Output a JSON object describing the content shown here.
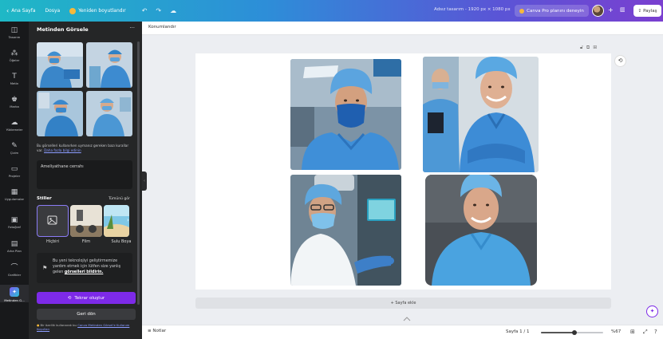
{
  "topbar": {
    "home": "Ana Sayfa",
    "file": "Dosya",
    "resize": "Yeniden boyutlandır",
    "design_size": "Adsız tasarım - 1920 px × 1080 px",
    "pro_cta": "Canva Pro planını deneyin",
    "share": "Paylaş",
    "gradient_start": "#1fb8c6",
    "gradient_end": "#7a3fd0"
  },
  "rail": {
    "items": [
      {
        "label": "Tasarım",
        "icon": "layout-icon"
      },
      {
        "label": "Öğeler",
        "icon": "elements-icon"
      },
      {
        "label": "Metin",
        "icon": "text-icon"
      },
      {
        "label": "Marka",
        "icon": "brand-icon"
      },
      {
        "label": "Yüklemeler",
        "icon": "upload-icon"
      },
      {
        "label": "Çizim",
        "icon": "draw-icon"
      },
      {
        "label": "Projeler",
        "icon": "folder-icon"
      },
      {
        "label": "Uygulamalar",
        "icon": "apps-icon"
      },
      {
        "label": "Fotoğraf",
        "icon": "photo-icon"
      },
      {
        "label": "Arka Plan",
        "icon": "background-icon"
      },
      {
        "label": "Grafikler",
        "icon": "chart-icon"
      },
      {
        "label": "Metinden G...",
        "icon": "text-to-image-icon"
      }
    ]
  },
  "panel": {
    "title": "Metinden Görsele",
    "more": "···",
    "helper_text": "Bu görselleri kullanırken uymanız gereken bazı kurallar var.",
    "helper_link": "Daha fazla bilgi edinin",
    "prompt": "Ameliyathane cerrahı",
    "styles_label": "Stiller",
    "styles_all": "Tümünü gör",
    "styles": [
      {
        "label": "Hiçbiri"
      },
      {
        "label": "Film"
      },
      {
        "label": "Sulu Boya"
      }
    ],
    "feedback_text": "Bu yeni teknolojiyi geliştirmemize yardım etmek için lütfen size yanlış gelen",
    "feedback_link": "görselleri bildirin.",
    "regenerate": "Tekrar oluştur",
    "back": "Geri dön",
    "terms_text": "Bir özellik kullanarak bu",
    "terms_link": "Canva Metinden Görsel'e Kullanım Koşulları",
    "accent": "#7d2ae8"
  },
  "editor": {
    "position_label": "Konumlandır",
    "add_page": "+ Sayfa ekle"
  },
  "bottombar": {
    "notes": "Notlar",
    "pages": "Sayfa 1 / 1",
    "zoom": "%67",
    "zoom_level": 0.54
  }
}
